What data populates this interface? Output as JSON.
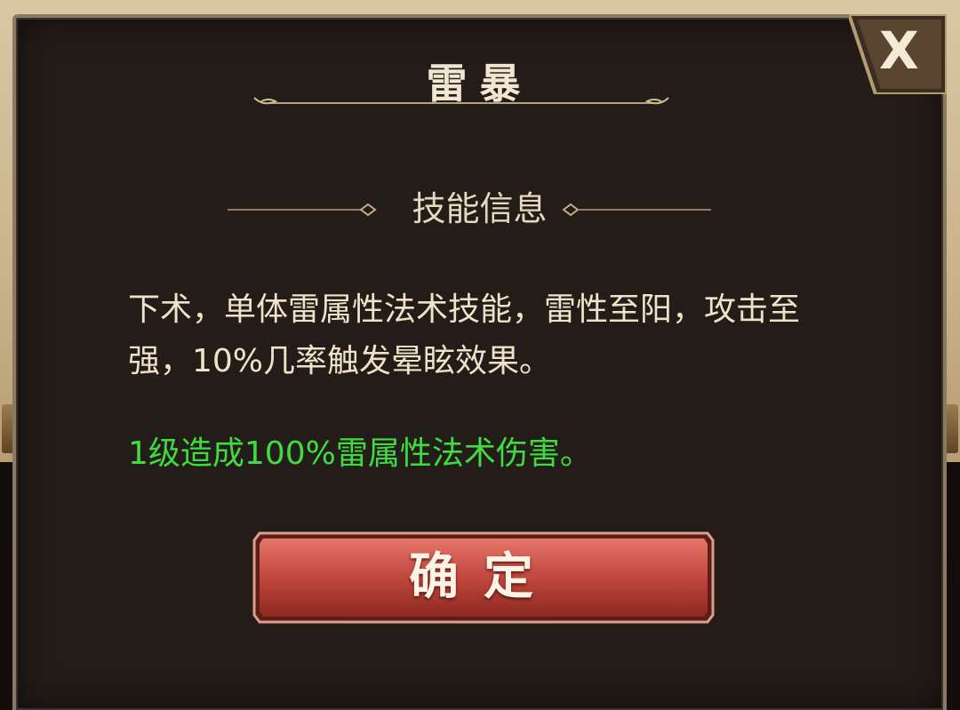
{
  "dialog": {
    "title": "雷暴",
    "close_label": "X",
    "section_header": "技能信息",
    "description": "下术，单体雷属性法术技能，雷性至阳，攻击至强，10%几率触发晕眩效果。",
    "effect": "1级造成100%雷属性法术伤害。",
    "confirm_label": "确定"
  },
  "icons": {
    "close": "close-icon",
    "title_ornament": "ornament-icon",
    "section_ornament": "ornament-icon"
  },
  "colors": {
    "panel_bg": "#231c19",
    "panel_border": "#8a7a62",
    "title_text": "#f1e6cf",
    "body_text": "#efe2c8",
    "effect_text": "#3fdc3f",
    "button_red": "#c2473d"
  }
}
